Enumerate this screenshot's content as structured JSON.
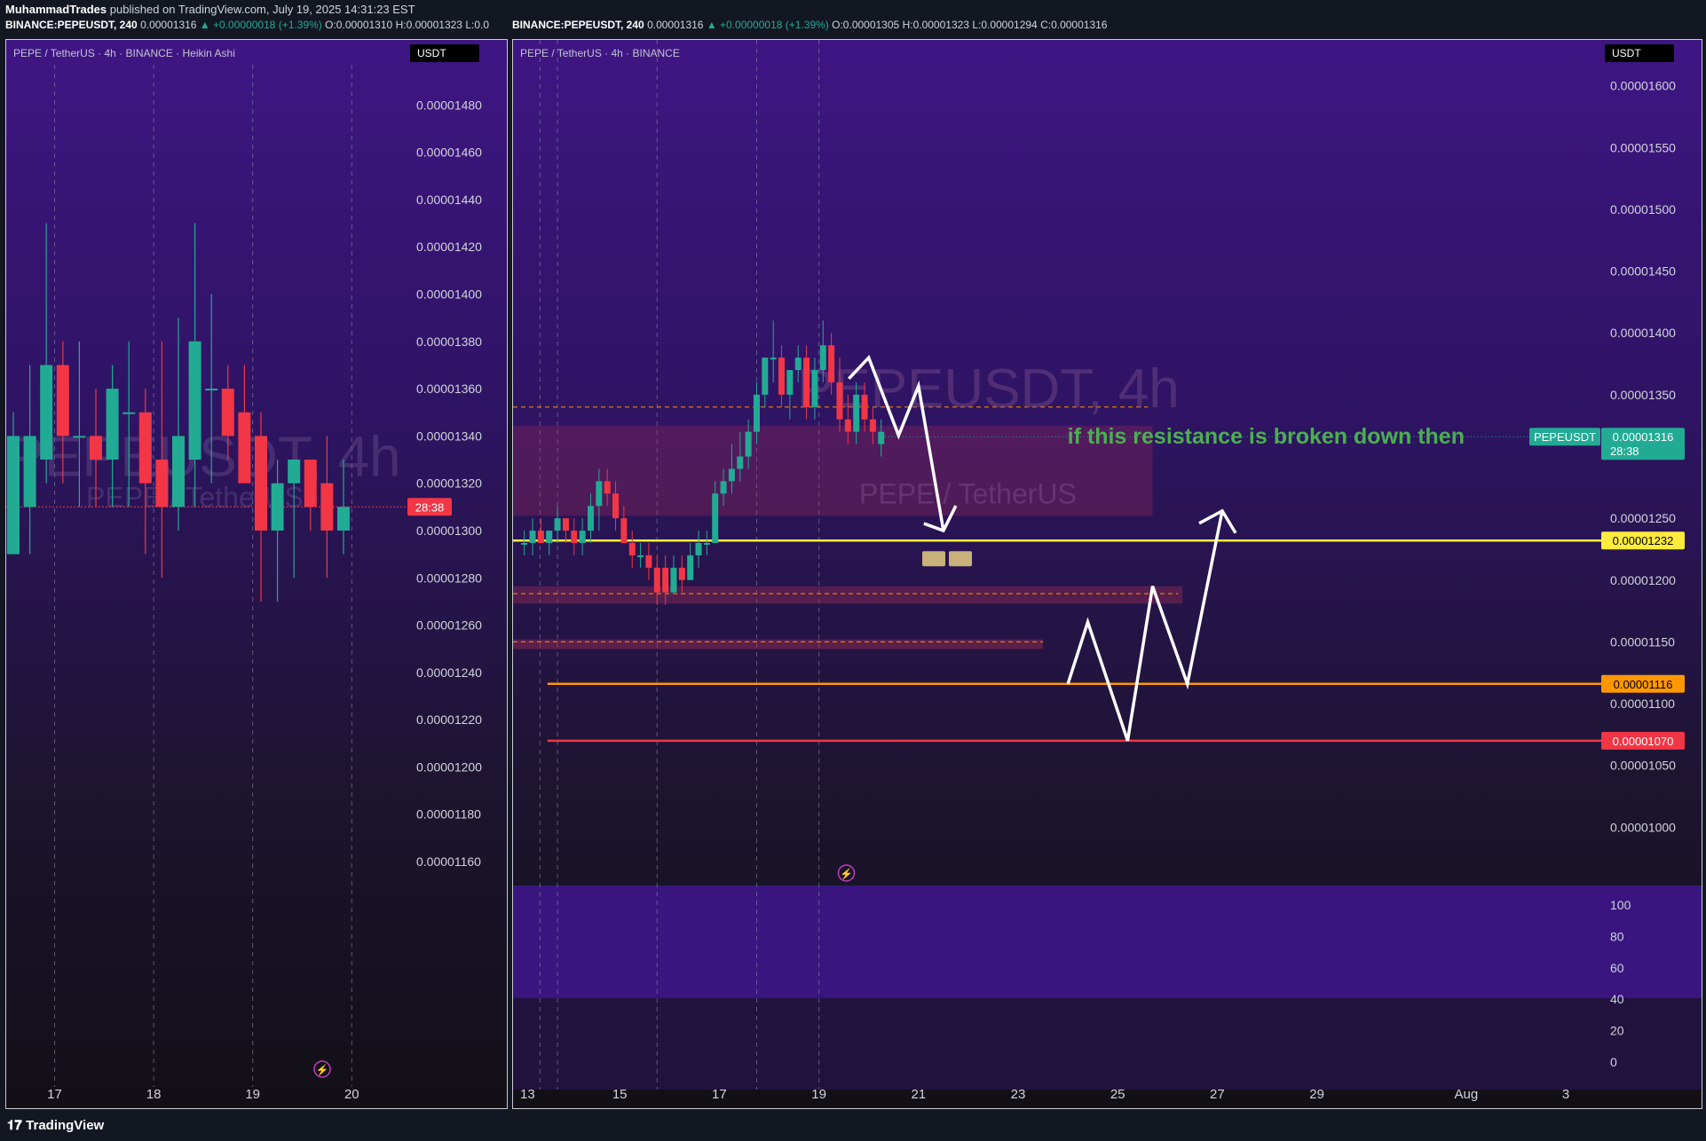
{
  "header": {
    "line1_user": "MuhammadTrades",
    "line1_rest": "published on TradingView.com, July 19, 2025 14:31:23 EST",
    "left_symbol": "BINANCE:PEPEUSDT, 240",
    "left_last": "0.00001316",
    "left_change": "▲ +0.00000018 (+1.39%)",
    "left_o": "O:0.00001310",
    "left_h": "H:0.00001323",
    "left_l": "L:0.0",
    "right_symbol": "BINANCE:PEPEUSDT, 240",
    "right_last": "0.00001316",
    "right_change": "▲ +0.00000018 (+1.39%)",
    "right_o": "O:0.00001305",
    "right_h": "H:0.00001323",
    "right_l": "L:0.00001294",
    "right_c": "C:0.00001316"
  },
  "footer": {
    "logo_text": "TradingView"
  },
  "colors": {
    "up": "#22ab94",
    "down": "#f23645",
    "yellow": "#ffeb3b",
    "orange": "#ff9800",
    "red_line": "#f23645",
    "text_green": "#4caf50"
  },
  "chart_data": [
    {
      "type": "candlestick",
      "title": "PEPE / TetherUS · 4h · BINANCE · Heikin Ashi",
      "unit_label": "USDT",
      "watermark": "PEPEUSDT, 4h",
      "watermark_sub": "PEPE / TetherUS",
      "y_ticks": [
        1.48e-05,
        1.46e-05,
        1.44e-05,
        1.42e-05,
        1.4e-05,
        1.38e-05,
        1.36e-05,
        1.34e-05,
        1.32e-05,
        1.3e-05,
        1.28e-05,
        1.26e-05,
        1.24e-05,
        1.22e-05,
        1.2e-05,
        1.18e-05,
        1.16e-05
      ],
      "y_tick_labels": [
        "0.00001480",
        "0.00001460",
        "0.00001440",
        "0.00001420",
        "0.00001400",
        "0.00001380",
        "0.00001360",
        "0.00001340",
        "0.00001320",
        "0.00001300",
        "0.00001280",
        "0.00001260",
        "0.00001240",
        "0.00001220",
        "0.00001200",
        "0.00001180",
        "0.00001160"
      ],
      "ylim": [
        1.148e-05,
        1.497e-05
      ],
      "x_labels": [
        {
          "index": 2.5,
          "label": "17"
        },
        {
          "index": 8.5,
          "label": "18"
        },
        {
          "index": 14.5,
          "label": "19"
        },
        {
          "index": 20.5,
          "label": "20"
        }
      ],
      "price_tag": {
        "value": 1.31e-05,
        "label": "28:38"
      },
      "candles": [
        {
          "o": 1.29e-05,
          "h": 1.35e-05,
          "l": 1.29e-05,
          "c": 1.34e-05
        },
        {
          "o": 1.31e-05,
          "h": 1.37e-05,
          "l": 1.29e-05,
          "c": 1.34e-05
        },
        {
          "o": 1.33e-05,
          "h": 1.43e-05,
          "l": 1.32e-05,
          "c": 1.37e-05
        },
        {
          "o": 1.37e-05,
          "h": 1.38e-05,
          "l": 1.32e-05,
          "c": 1.34e-05
        },
        {
          "o": 1.34e-05,
          "h": 1.38e-05,
          "l": 1.31e-05,
          "c": 1.34e-05
        },
        {
          "o": 1.34e-05,
          "h": 1.36e-05,
          "l": 1.31e-05,
          "c": 1.33e-05
        },
        {
          "o": 1.33e-05,
          "h": 1.37e-05,
          "l": 1.31e-05,
          "c": 1.36e-05
        },
        {
          "o": 1.35e-05,
          "h": 1.38e-05,
          "l": 1.31e-05,
          "c": 1.35e-05
        },
        {
          "o": 1.35e-05,
          "h": 1.36e-05,
          "l": 1.29e-05,
          "c": 1.32e-05
        },
        {
          "o": 1.33e-05,
          "h": 1.38e-05,
          "l": 1.28e-05,
          "c": 1.31e-05
        },
        {
          "o": 1.31e-05,
          "h": 1.39e-05,
          "l": 1.3e-05,
          "c": 1.34e-05
        },
        {
          "o": 1.33e-05,
          "h": 1.43e-05,
          "l": 1.31e-05,
          "c": 1.38e-05
        },
        {
          "o": 1.36e-05,
          "h": 1.4e-05,
          "l": 1.32e-05,
          "c": 1.36e-05
        },
        {
          "o": 1.36e-05,
          "h": 1.37e-05,
          "l": 1.33e-05,
          "c": 1.34e-05
        },
        {
          "o": 1.35e-05,
          "h": 1.37e-05,
          "l": 1.32e-05,
          "c": 1.32e-05
        },
        {
          "o": 1.34e-05,
          "h": 1.35e-05,
          "l": 1.27e-05,
          "c": 1.3e-05
        },
        {
          "o": 1.3e-05,
          "h": 1.33e-05,
          "l": 1.27e-05,
          "c": 1.32e-05
        },
        {
          "o": 1.32e-05,
          "h": 1.33e-05,
          "l": 1.28e-05,
          "c": 1.33e-05
        },
        {
          "o": 1.33e-05,
          "h": 1.33e-05,
          "l": 1.3e-05,
          "c": 1.31e-05
        },
        {
          "o": 1.32e-05,
          "h": 1.34e-05,
          "l": 1.28e-05,
          "c": 1.3e-05
        },
        {
          "o": 1.3e-05,
          "h": 1.33e-05,
          "l": 1.29e-05,
          "c": 1.31e-05
        }
      ]
    },
    {
      "type": "candlestick",
      "title": "PEPE / TetherUS · 4h · BINANCE",
      "unit_label": "USDT",
      "watermark": "PEPEUSDT, 4h",
      "watermark_sub": "PEPE / TetherUS",
      "y_ticks": [
        1.6e-05,
        1.55e-05,
        1.5e-05,
        1.45e-05,
        1.4e-05,
        1.35e-05,
        1.25e-05,
        1.2e-05,
        1.15e-05,
        1.1e-05,
        1.05e-05,
        1e-05
      ],
      "y_tick_labels": [
        "0.00001600",
        "0.00001550",
        "0.00001500",
        "0.00001450",
        "0.00001400",
        "0.00001350",
        "0.00001250",
        "0.00001200",
        "0.00001150",
        "0.00001100",
        "0.00001050",
        "0.00001000"
      ],
      "ylim": [
        9.55e-06,
        1.617e-05
      ],
      "x_labels": [
        {
          "day": 13,
          "label": "13"
        },
        {
          "day": 15,
          "label": "15"
        },
        {
          "day": 17,
          "label": "17"
        },
        {
          "day": 19,
          "label": "19"
        },
        {
          "day": 21,
          "label": "21"
        },
        {
          "day": 23,
          "label": "23"
        },
        {
          "day": 25,
          "label": "25"
        },
        {
          "day": 27,
          "label": "27"
        },
        {
          "day": 29,
          "label": "29"
        },
        {
          "day": 32,
          "label": "Aug"
        },
        {
          "day": 34,
          "label": "3"
        }
      ],
      "first_day": 13,
      "candles_per_day": 6,
      "last_price": {
        "label": "PEPEUSDT",
        "value": "0.00001316",
        "countdown": "28:38",
        "y": 1.316e-05
      },
      "levels": [
        {
          "name": "resistance-line",
          "value": 1.232e-05,
          "label": "0.00001232",
          "color": "#ffeb3b"
        },
        {
          "name": "support-line",
          "value": 1.116e-05,
          "label": "0.00001116",
          "color": "#ff9800"
        },
        {
          "name": "low-line",
          "value": 1.07e-05,
          "label": "0.00001070",
          "color": "#f23645"
        }
      ],
      "annotation": "if this resistance is broken down then",
      "resistance_zone": {
        "top": 1.325e-05,
        "bottom": 1.252e-05,
        "start_day": 13,
        "end_day": 25.7
      },
      "zone2": {
        "top": 1.195e-05,
        "bottom": 1.181e-05,
        "start_day": 13,
        "end_day": 26.3
      },
      "zone3": {
        "top": 1.152e-05,
        "bottom": 1.147e-05,
        "start_day": 13,
        "end_day": 23.5
      },
      "candles": [
        {
          "o": 1.23e-05,
          "h": 1.24e-05,
          "l": 1.22e-05,
          "c": 1.23e-05
        },
        {
          "o": 1.23e-05,
          "h": 1.25e-05,
          "l": 1.22e-05,
          "c": 1.24e-05
        },
        {
          "o": 1.24e-05,
          "h": 1.25e-05,
          "l": 1.23e-05,
          "c": 1.23e-05
        },
        {
          "o": 1.23e-05,
          "h": 1.24e-05,
          "l": 1.22e-05,
          "c": 1.24e-05
        },
        {
          "o": 1.24e-05,
          "h": 1.26e-05,
          "l": 1.23e-05,
          "c": 1.25e-05
        },
        {
          "o": 1.25e-05,
          "h": 1.25e-05,
          "l": 1.23e-05,
          "c": 1.24e-05
        },
        {
          "o": 1.24e-05,
          "h": 1.25e-05,
          "l": 1.22e-05,
          "c": 1.23e-05
        },
        {
          "o": 1.23e-05,
          "h": 1.25e-05,
          "l": 1.22e-05,
          "c": 1.24e-05
        },
        {
          "o": 1.24e-05,
          "h": 1.27e-05,
          "l": 1.23e-05,
          "c": 1.26e-05
        },
        {
          "o": 1.26e-05,
          "h": 1.29e-05,
          "l": 1.24e-05,
          "c": 1.28e-05
        },
        {
          "o": 1.28e-05,
          "h": 1.29e-05,
          "l": 1.26e-05,
          "c": 1.27e-05
        },
        {
          "o": 1.27e-05,
          "h": 1.28e-05,
          "l": 1.24e-05,
          "c": 1.25e-05
        },
        {
          "o": 1.25e-05,
          "h": 1.26e-05,
          "l": 1.23e-05,
          "c": 1.23e-05
        },
        {
          "o": 1.23e-05,
          "h": 1.24e-05,
          "l": 1.21e-05,
          "c": 1.22e-05
        },
        {
          "o": 1.22e-05,
          "h": 1.23e-05,
          "l": 1.21e-05,
          "c": 1.22e-05
        },
        {
          "o": 1.22e-05,
          "h": 1.23e-05,
          "l": 1.2e-05,
          "c": 1.21e-05
        },
        {
          "o": 1.21e-05,
          "h": 1.22e-05,
          "l": 1.18e-05,
          "c": 1.19e-05
        },
        {
          "o": 1.21e-05,
          "h": 1.22e-05,
          "l": 1.18e-05,
          "c": 1.19e-05
        },
        {
          "o": 1.19e-05,
          "h": 1.22e-05,
          "l": 1.19e-05,
          "c": 1.21e-05
        },
        {
          "o": 1.21e-05,
          "h": 1.22e-05,
          "l": 1.19e-05,
          "c": 1.2e-05
        },
        {
          "o": 1.2e-05,
          "h": 1.23e-05,
          "l": 1.2e-05,
          "c": 1.22e-05
        },
        {
          "o": 1.22e-05,
          "h": 1.24e-05,
          "l": 1.21e-05,
          "c": 1.23e-05
        },
        {
          "o": 1.23e-05,
          "h": 1.24e-05,
          "l": 1.22e-05,
          "c": 1.23e-05
        },
        {
          "o": 1.23e-05,
          "h": 1.28e-05,
          "l": 1.23e-05,
          "c": 1.27e-05
        },
        {
          "o": 1.27e-05,
          "h": 1.29e-05,
          "l": 1.26e-05,
          "c": 1.28e-05
        },
        {
          "o": 1.28e-05,
          "h": 1.31e-05,
          "l": 1.27e-05,
          "c": 1.29e-05
        },
        {
          "o": 1.29e-05,
          "h": 1.32e-05,
          "l": 1.28e-05,
          "c": 1.3e-05
        },
        {
          "o": 1.3e-05,
          "h": 1.33e-05,
          "l": 1.29e-05,
          "c": 1.32e-05
        },
        {
          "o": 1.32e-05,
          "h": 1.36e-05,
          "l": 1.31e-05,
          "c": 1.35e-05
        },
        {
          "o": 1.35e-05,
          "h": 1.38e-05,
          "l": 1.34e-05,
          "c": 1.38e-05
        },
        {
          "o": 1.38e-05,
          "h": 1.41e-05,
          "l": 1.36e-05,
          "c": 1.38e-05
        },
        {
          "o": 1.38e-05,
          "h": 1.39e-05,
          "l": 1.34e-05,
          "c": 1.35e-05
        },
        {
          "o": 1.35e-05,
          "h": 1.37e-05,
          "l": 1.33e-05,
          "c": 1.37e-05
        },
        {
          "o": 1.37e-05,
          "h": 1.39e-05,
          "l": 1.36e-05,
          "c": 1.38e-05
        },
        {
          "o": 1.38e-05,
          "h": 1.39e-05,
          "l": 1.33e-05,
          "c": 1.34e-05
        },
        {
          "o": 1.34e-05,
          "h": 1.38e-05,
          "l": 1.33e-05,
          "c": 1.37e-05
        },
        {
          "o": 1.37e-05,
          "h": 1.41e-05,
          "l": 1.36e-05,
          "c": 1.39e-05
        },
        {
          "o": 1.39e-05,
          "h": 1.4e-05,
          "l": 1.35e-05,
          "c": 1.36e-05
        },
        {
          "o": 1.36e-05,
          "h": 1.38e-05,
          "l": 1.32e-05,
          "c": 1.33e-05
        },
        {
          "o": 1.33e-05,
          "h": 1.35e-05,
          "l": 1.31e-05,
          "c": 1.32e-05
        },
        {
          "o": 1.32e-05,
          "h": 1.36e-05,
          "l": 1.31e-05,
          "c": 1.35e-05
        },
        {
          "o": 1.35e-05,
          "h": 1.36e-05,
          "l": 1.32e-05,
          "c": 1.33e-05
        },
        {
          "o": 1.33e-05,
          "h": 1.34e-05,
          "l": 1.31e-05,
          "c": 1.32e-05
        },
        {
          "o": 1.31e-05,
          "h": 1.33e-05,
          "l": 1.3e-05,
          "c": 1.32e-05
        }
      ],
      "drawn_path_down": [
        [
          19.6,
          1.363e-05
        ],
        [
          20,
          1.38e-05
        ],
        [
          20.6,
          1.317e-05
        ],
        [
          21,
          1.357e-05
        ],
        [
          21.5,
          1.24e-05
        ]
      ],
      "drawn_path_up": [
        [
          24,
          1.116e-05
        ],
        [
          24.4,
          1.166e-05
        ],
        [
          25.2,
          1.07e-05
        ],
        [
          25.7,
          1.195e-05
        ],
        [
          26.4,
          1.116e-05
        ],
        [
          27.1,
          1.256e-05
        ]
      ],
      "oscillator": {
        "ticks": [
          100,
          80,
          60,
          40,
          20,
          0
        ],
        "tick_labels": [
          "100",
          "80",
          "60",
          "40",
          "20",
          "0"
        ]
      }
    }
  ]
}
